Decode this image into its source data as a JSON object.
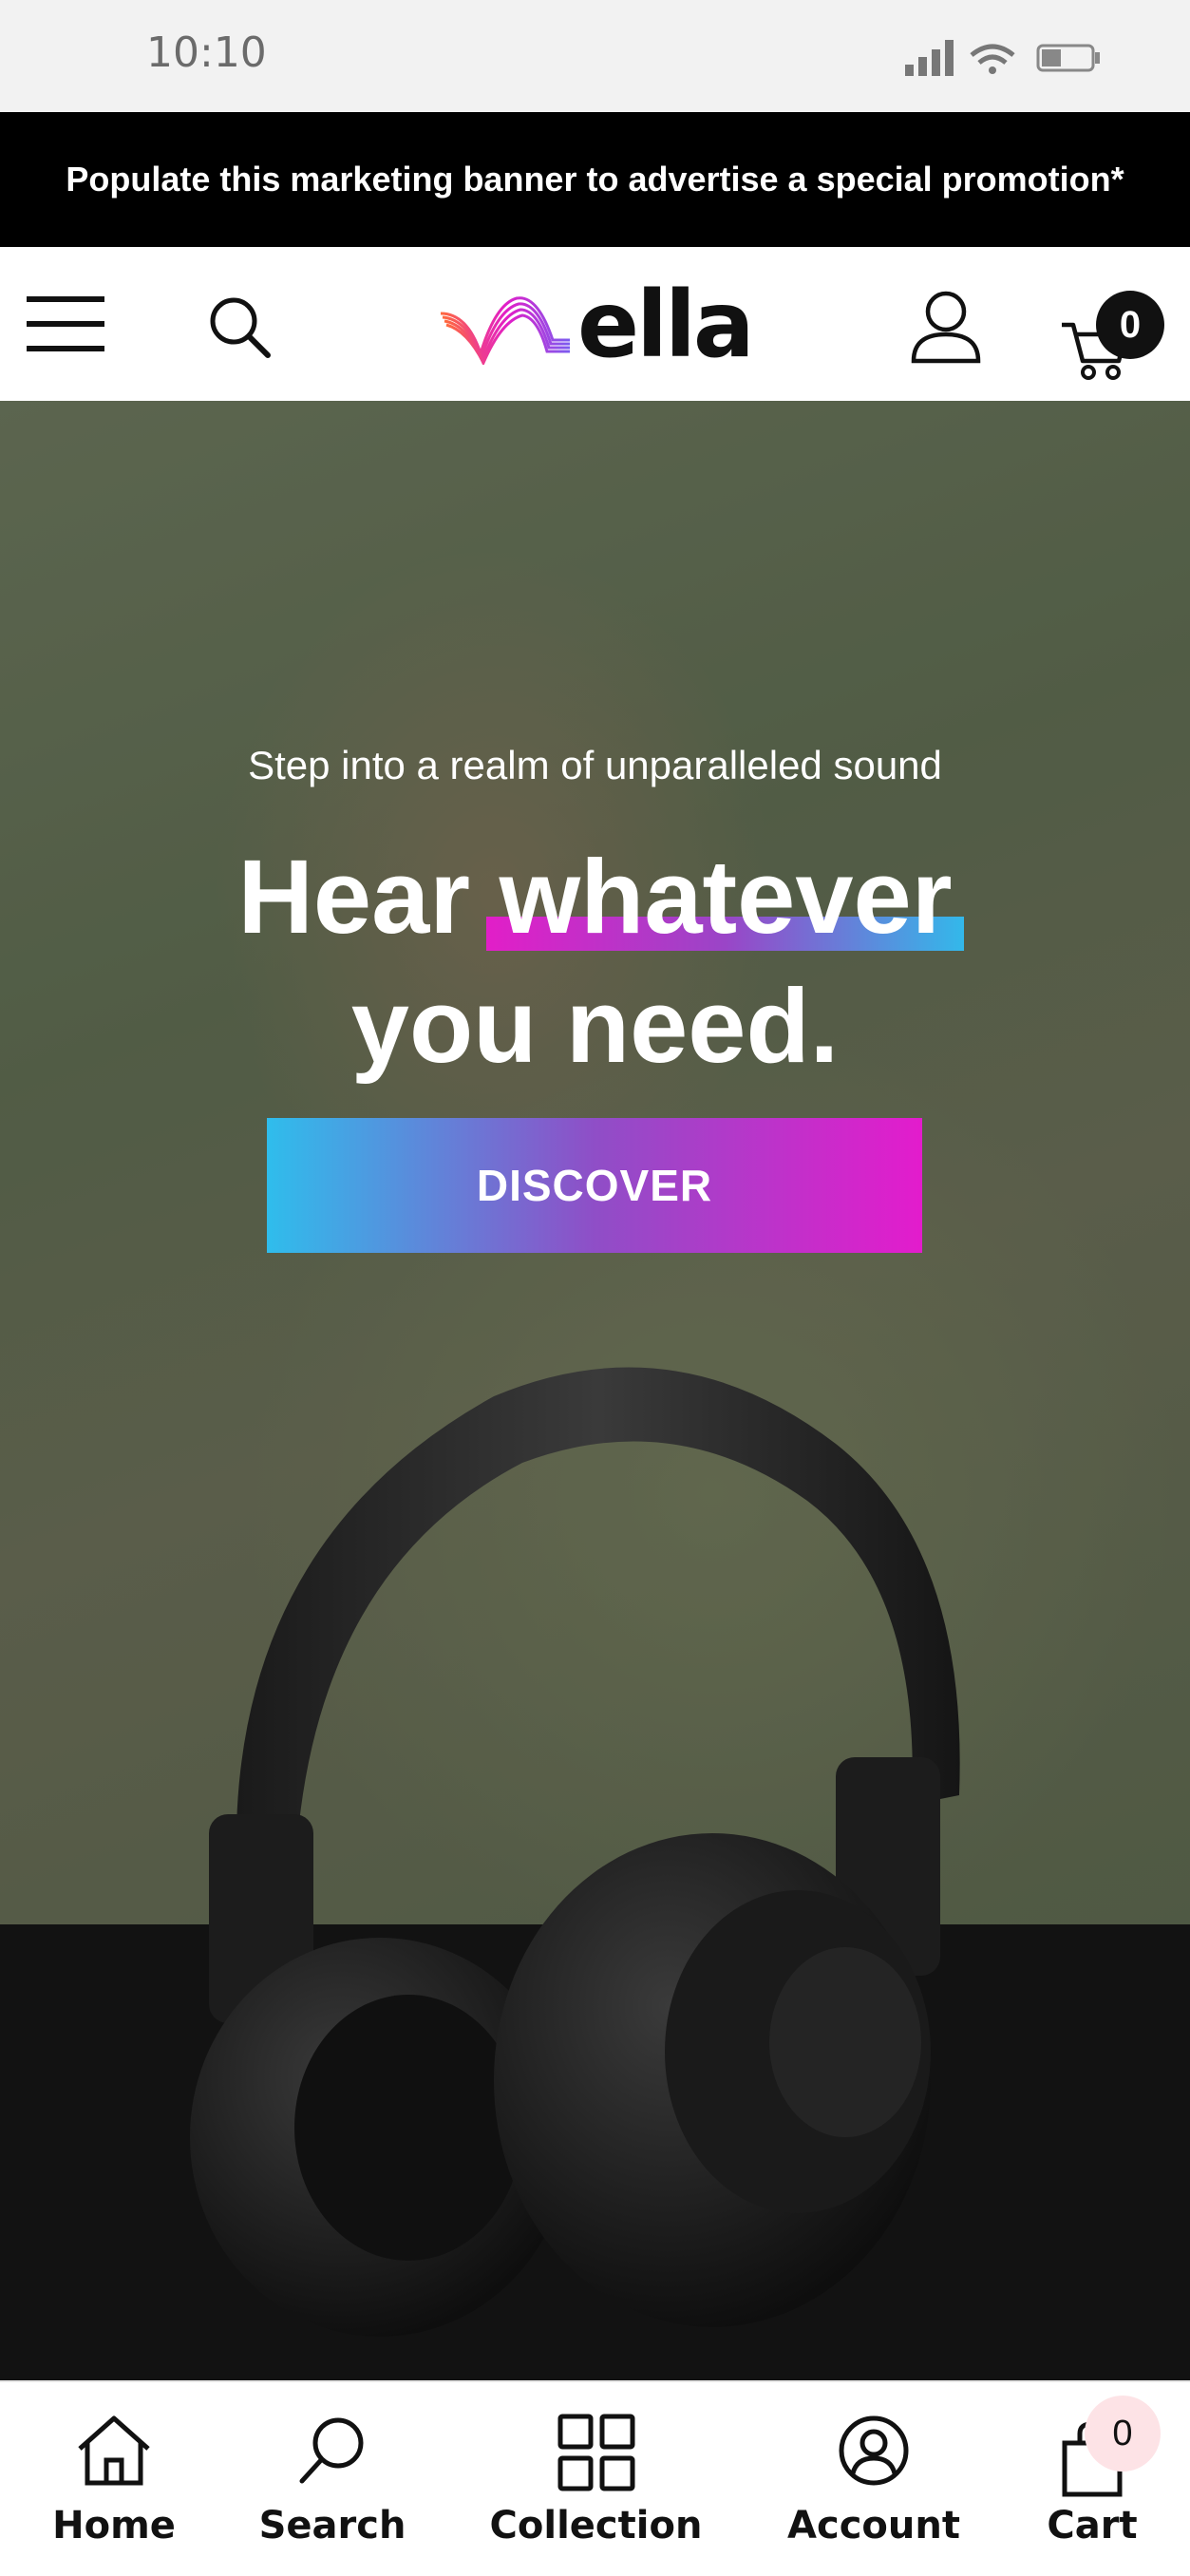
{
  "status_bar": {
    "time": "10:10"
  },
  "promo": {
    "text": "Populate this marketing banner to advertise a special promotion*"
  },
  "header": {
    "logo_text": "ella",
    "cart_count": "0"
  },
  "hero": {
    "subtitle": "Step into a realm of unparalleled sound",
    "title_word1": "Hear",
    "title_highlight": "whatever",
    "title_line2": "you need.",
    "cta_label": "DISCOVER"
  },
  "bottom_nav": {
    "items": [
      {
        "label": "Home",
        "icon": "home-icon"
      },
      {
        "label": "Search",
        "icon": "search-icon"
      },
      {
        "label": "Collection",
        "icon": "grid-icon"
      },
      {
        "label": "Account",
        "icon": "account-icon"
      },
      {
        "label": "Cart",
        "icon": "bag-icon"
      }
    ],
    "cart_badge": "0"
  },
  "colors": {
    "gradient_pink": "#e21ec8",
    "gradient_purple": "#9a45c7",
    "gradient_blue": "#33b8ea"
  }
}
